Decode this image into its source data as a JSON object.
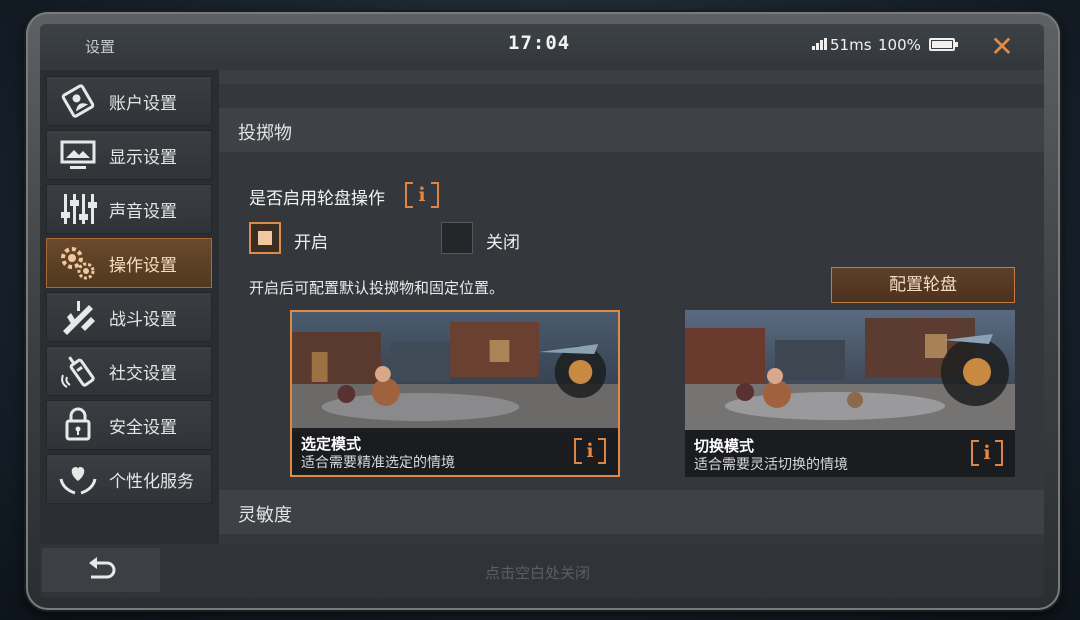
{
  "window": {
    "title": "设置",
    "time": "17:04",
    "ping": "51ms",
    "battery": "100%",
    "close_icon": "close-x-icon"
  },
  "sidebar": {
    "items": [
      {
        "label": "账户设置",
        "icon": "account-card-icon",
        "active": false
      },
      {
        "label": "显示设置",
        "icon": "monitor-icon",
        "active": false
      },
      {
        "label": "声音设置",
        "icon": "sliders-icon",
        "active": false
      },
      {
        "label": "操作设置",
        "icon": "gears-icon",
        "active": true
      },
      {
        "label": "战斗设置",
        "icon": "rifle-icon",
        "active": false
      },
      {
        "label": "社交设置",
        "icon": "walkie-talkie-icon",
        "active": false
      },
      {
        "label": "安全设置",
        "icon": "lock-icon",
        "active": false
      },
      {
        "label": "个性化服务",
        "icon": "heart-hands-icon",
        "active": false
      }
    ]
  },
  "main": {
    "section_throwables": "投掷物",
    "wheel_question": "是否启用轮盘操作",
    "info_glyph": "i",
    "options": {
      "on": "开启",
      "off": "关闭",
      "selected": "on"
    },
    "description": "开启后可配置默认投掷物和固定位置。",
    "config_button": "配置轮盘",
    "modes": [
      {
        "title": "选定模式",
        "subtitle": "适合需要精准选定的情境",
        "selected": true
      },
      {
        "title": "切换模式",
        "subtitle": "适合需要灵活切换的情境",
        "selected": false
      }
    ],
    "section_sensitivity": "灵敏度"
  },
  "footer": {
    "hint": "点击空白处关闭",
    "back_icon": "back-arrow-icon"
  },
  "colors": {
    "accent": "#e08a48",
    "active_nav": "#5e4028",
    "panel": "#34383c"
  }
}
